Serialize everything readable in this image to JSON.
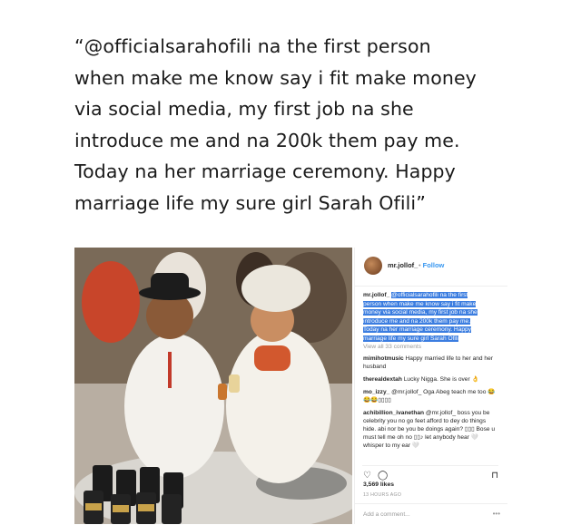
{
  "quote": {
    "lines": [
      "“@officialsarahofili na  the first person",
      "when make me know say i fit make money",
      "via social media, my first job na she",
      "introduce me and na 200k them pay me.",
      "Today na her marriage ceremony. Happy",
      "marriage life my sure girl Sarah Ofili”"
    ]
  },
  "post": {
    "username": "mr.jollof_",
    "follow_label": "Follow",
    "caption_user": "mr.jollof_",
    "caption_lines": [
      "@officialsarahofili na the first",
      "person when make me know say i fit make",
      "money via social media, my first job na she",
      "introduce me and na 200k them pay me.",
      "Today na her marriage ceremony. Happy",
      "marriage life my sure girl Sarah Ofili"
    ],
    "view_all": "View all 33 comments",
    "comments": [
      {
        "user": "mimihotmusic",
        "text": "Happy married life to her and her husband"
      },
      {
        "user": "therealdextah",
        "text": "Lucky Nigga. She is over 👌"
      },
      {
        "user": "mo_izzy_",
        "text": "@mr.jollof_ Oga Abeg teach me too 😂😂😂▯▯▯▯"
      },
      {
        "user": "achibillion_ivanethan",
        "text": "@mr.jollof_ boss you be celebrity you no go feet afford to dey do things hide. abi nor be you be doings again? ▯▯▯ Bose u must tell me oh no ▯▯♪ let anybody hear 🤍 whisper to my ear 🤍"
      }
    ],
    "likes": "3,569 likes",
    "time_ago": "13 HOURS AGO",
    "add_comment_placeholder": "Add a comment...",
    "icons": [
      "heart-icon",
      "comment-icon",
      "bookmark-icon",
      "more-icon"
    ]
  }
}
